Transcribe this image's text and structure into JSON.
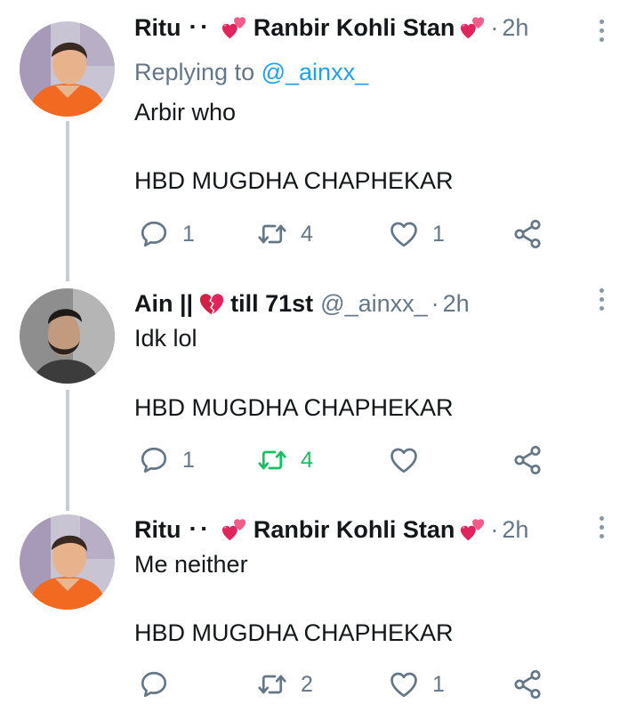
{
  "tweets": [
    {
      "author": "Ritu",
      "name_suffix": "Ranbir Kohli Stan",
      "separator": "·",
      "time": "2h",
      "replying_label": "Replying to",
      "replying_handle": "@_ainxx_",
      "lines": [
        "Arbir who",
        "HBD MUGDHA CHAPHEKAR"
      ],
      "reply_count": "1",
      "retweet_count": "4",
      "like_count": "1"
    },
    {
      "author": "Ain ||",
      "name_suffix": "till 71st",
      "handle": "@_ainxx_",
      "separator": "·",
      "time": "2h",
      "lines": [
        "Idk lol",
        "HBD MUGDHA CHAPHEKAR"
      ],
      "reply_count": "1",
      "retweet_count": "4",
      "retweeted": true,
      "like_count": ""
    },
    {
      "author": "Ritu",
      "name_suffix": "Ranbir Kohli Stan",
      "separator": "·",
      "time": "2h",
      "lines": [
        "Me neither",
        "HBD MUGDHA CHAPHEKAR"
      ],
      "reply_count": "",
      "retweet_count": "2",
      "like_count": "1"
    }
  ],
  "colors": {
    "text": "#14171a",
    "secondary": "#657786",
    "link": "#1da1f2",
    "retweet_active": "#17bf63",
    "thread_line": "#c4cfd6",
    "heart_emoji": "#e0245e"
  },
  "icons": [
    "reply-icon",
    "retweet-icon",
    "like-icon",
    "share-icon",
    "more-options-icon",
    "revolving-hearts-icon",
    "broken-heart-icon"
  ]
}
